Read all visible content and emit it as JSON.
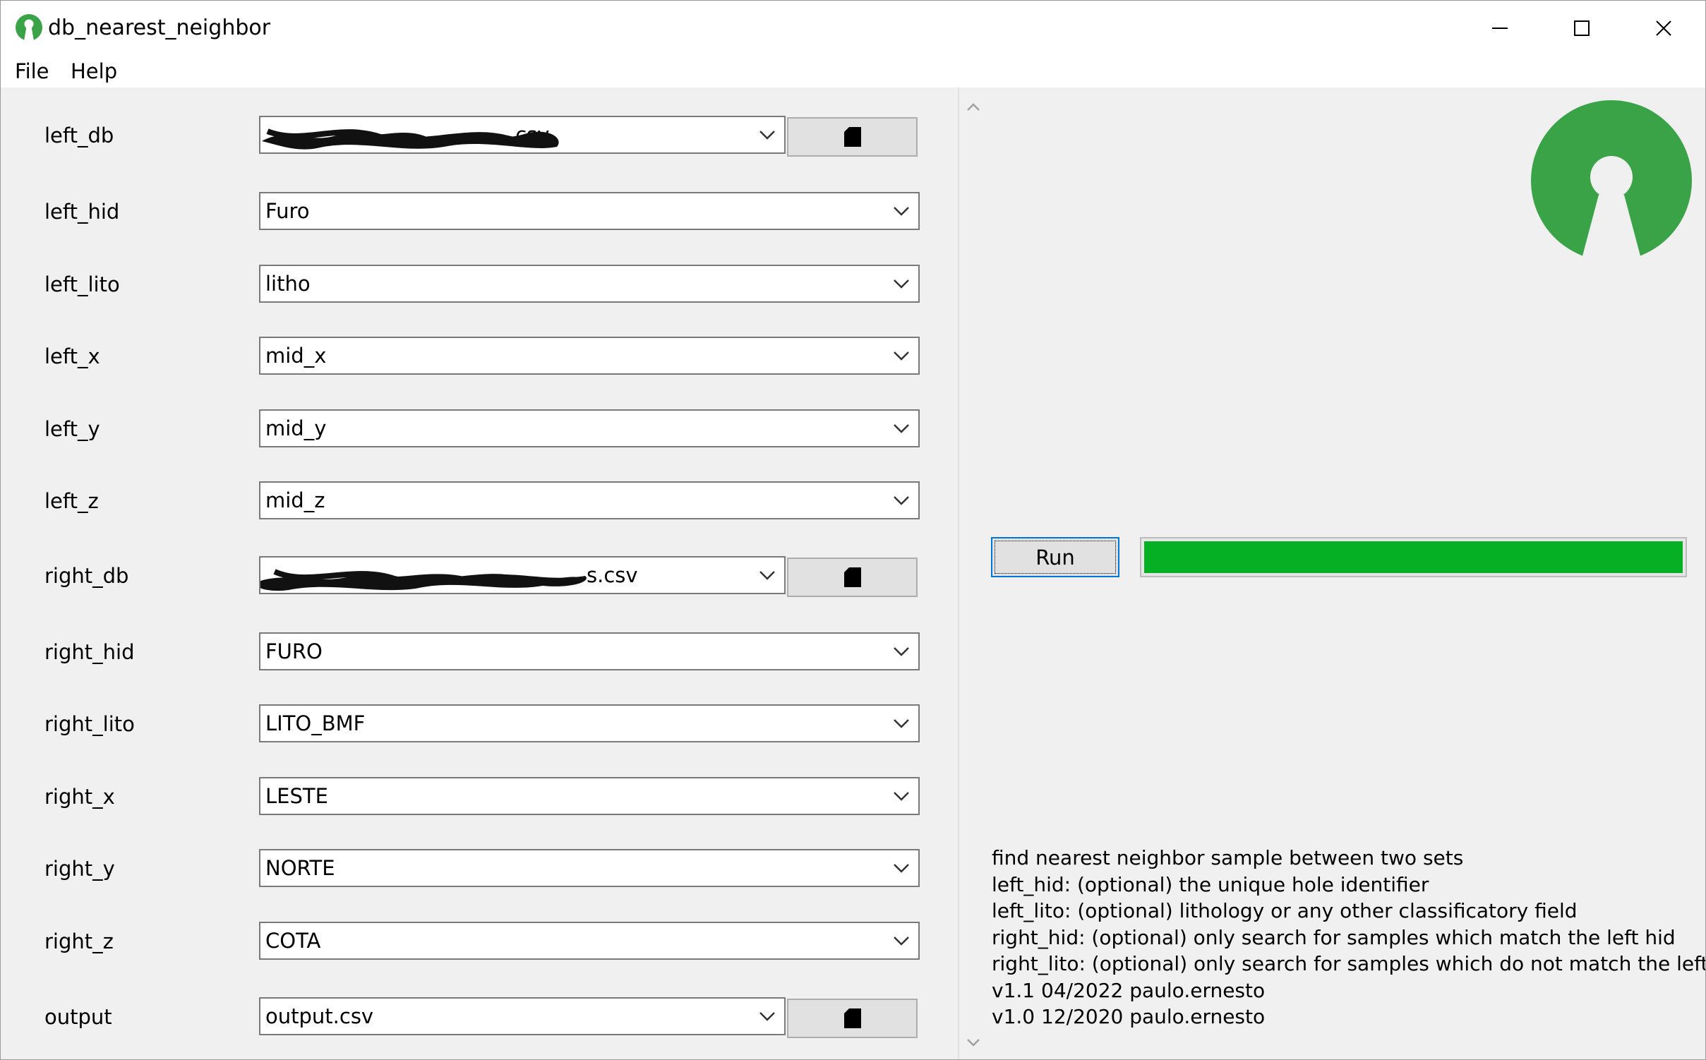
{
  "window": {
    "title": "db_nearest_neighbor",
    "minimize_icon": "minimize-icon",
    "maximize_icon": "maximize-icon",
    "close_icon": "close-icon"
  },
  "menu": [
    "File",
    "Help"
  ],
  "fields": [
    {
      "label": "left_db",
      "value": ".csv",
      "browse_icon": "file-icon"
    },
    {
      "label": "left_hid",
      "value": "Furo"
    },
    {
      "label": "left_lito",
      "value": "litho"
    },
    {
      "label": "left_x",
      "value": "mid_x"
    },
    {
      "label": "left_y",
      "value": "mid_y"
    },
    {
      "label": "left_z",
      "value": "mid_z"
    },
    {
      "label": "right_db",
      "value": "s.csv",
      "browse_icon": "file-icon"
    },
    {
      "label": "right_hid",
      "value": "FURO"
    },
    {
      "label": "right_lito",
      "value": "LITO_BMF"
    },
    {
      "label": "right_x",
      "value": "LESTE"
    },
    {
      "label": "right_y",
      "value": "NORTE"
    },
    {
      "label": "right_z",
      "value": "COTA"
    },
    {
      "label": "output",
      "value": "output.csv",
      "browse_icon": "file-icon"
    }
  ],
  "run": {
    "label": "Run",
    "progress": 1.0
  },
  "info_lines": [
    "find nearest neighbor sample between two sets",
    "left_hid: (optional) the unique hole identifier",
    "left_lito: (optional) lithology or any other classificatory field",
    "right_hid: (optional) only search for samples which match the left hid",
    "right_lito: (optional) only search for samples which do not match the left lito",
    "v1.1 04/2022 paulo.ernesto",
    "v1.0 12/2020 paulo.ernesto"
  ],
  "colors": {
    "logo_green": "#3aa347",
    "progress_green": "#06b025",
    "focus_border": "#0078d7"
  }
}
